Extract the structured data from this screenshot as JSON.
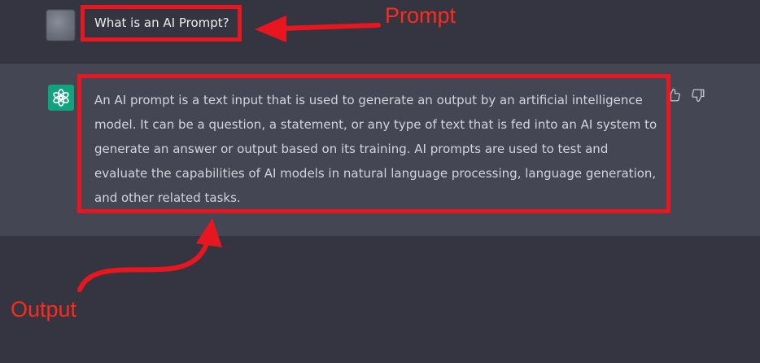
{
  "conversation": {
    "user_message": "What is an AI Prompt?",
    "assistant_message": "An AI prompt is a text input that is used to generate an output by an artificial intelligence model. It can be a question, a statement, or any type of text that is fed into an AI system to generate an answer or output based on its training. AI prompts are used to test and evaluate the capabilities of AI models in natural language processing, language generation, and other related tasks."
  },
  "annotations": {
    "prompt_label": "Prompt",
    "output_label": "Output",
    "color": "#e8171f"
  },
  "icons": {
    "assistant_avatar": "openai-logo-icon",
    "thumbs_up": "thumbs-up-icon",
    "thumbs_down": "thumbs-down-icon"
  },
  "colors": {
    "background": "#343541",
    "assistant_row": "#444654",
    "logo_green": "#10a37f"
  }
}
